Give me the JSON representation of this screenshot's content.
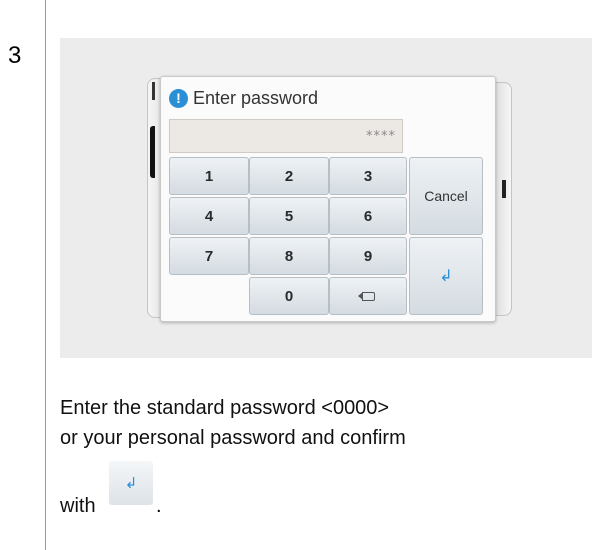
{
  "step": {
    "number": "3"
  },
  "screen": {
    "dialog": {
      "title": "Enter password",
      "icon": "info-icon",
      "password_field": {
        "value": "****"
      },
      "keys": {
        "k1": "1",
        "k2": "2",
        "k3": "3",
        "k4": "4",
        "k5": "5",
        "k6": "6",
        "k7": "7",
        "k8": "8",
        "k9": "9",
        "k0": "0",
        "cancel": "Cancel",
        "enter": "↲",
        "delete_icon": "backspace-icon"
      }
    },
    "back_button": {
      "icon": "back-arrow-icon",
      "glyph": "↰"
    }
  },
  "instruction": {
    "line1": "Enter the standard password <0000>",
    "line2": "or your personal password and confirm",
    "with": "with",
    "enter_glyph": "↲",
    "period": "."
  },
  "colors": {
    "accent_blue": "#2a8fd4",
    "back_button": "#1c5c86"
  }
}
